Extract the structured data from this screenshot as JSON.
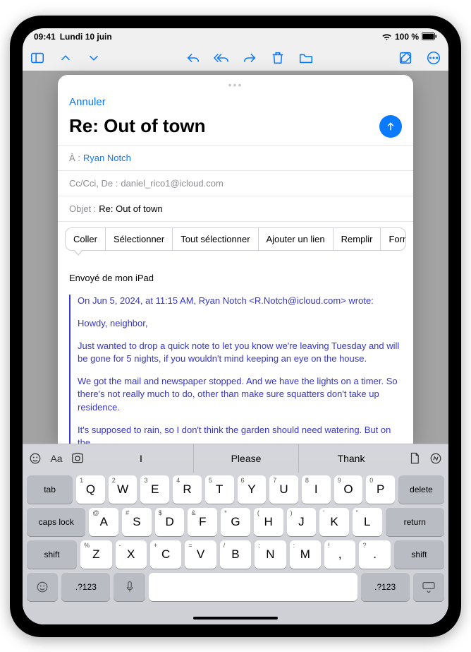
{
  "status": {
    "time": "09:41",
    "date": "Lundi 10 juin",
    "battery": "100 %"
  },
  "sheet": {
    "cancel": "Annuler",
    "title": "Re: Out of town",
    "to_label": "À :",
    "to_value": "Ryan Notch",
    "cc_label": "Cc/Cci, De :",
    "cc_value": "daniel_rico1@icloud.com",
    "subject_label": "Objet :",
    "subject_value": "Re: Out of town"
  },
  "edit_menu": {
    "paste": "Coller",
    "select": "Sélectionner",
    "select_all": "Tout sélectionner",
    "add_link": "Ajouter un lien",
    "fill": "Remplir",
    "format": "Format"
  },
  "body": {
    "signature": "Envoyé de mon iPad",
    "quote_header": "On Jun 5, 2024, at 11:15 AM, Ryan Notch <R.Notch@icloud.com> wrote:",
    "p1": "Howdy, neighbor,",
    "p2": "Just wanted to drop a quick note to let you know we're leaving Tuesday and will be gone for 5 nights, if you wouldn't mind keeping an eye on the house.",
    "p3": "We got the mail and newspaper stopped. And we have the lights on a timer. So there's not really much to do, other than make sure squatters don't take up residence.",
    "p4": "It's supposed to rain, so I don't think the garden should need watering. But on the"
  },
  "keyboard": {
    "sugg": [
      "I",
      "Please",
      "Thank"
    ],
    "row1": [
      {
        "m": "Q",
        "a": "1"
      },
      {
        "m": "W",
        "a": "2"
      },
      {
        "m": "E",
        "a": "3"
      },
      {
        "m": "R",
        "a": "4"
      },
      {
        "m": "T",
        "a": "5"
      },
      {
        "m": "Y",
        "a": "6"
      },
      {
        "m": "U",
        "a": "7"
      },
      {
        "m": "I",
        "a": "8"
      },
      {
        "m": "O",
        "a": "9"
      },
      {
        "m": "P",
        "a": "0"
      }
    ],
    "row2": [
      {
        "m": "A",
        "a": "@"
      },
      {
        "m": "S",
        "a": "#"
      },
      {
        "m": "D",
        "a": "$"
      },
      {
        "m": "F",
        "a": "&"
      },
      {
        "m": "G",
        "a": "*"
      },
      {
        "m": "H",
        "a": "("
      },
      {
        "m": "J",
        "a": ")"
      },
      {
        "m": "K",
        "a": "'"
      },
      {
        "m": "L",
        "a": "\""
      }
    ],
    "row3": [
      {
        "m": "Z",
        "a": "%"
      },
      {
        "m": "X",
        "a": "-"
      },
      {
        "m": "C",
        "a": "+"
      },
      {
        "m": "V",
        "a": "="
      },
      {
        "m": "B",
        "a": "/"
      },
      {
        "m": "N",
        "a": ";"
      },
      {
        "m": "M",
        "a": ":"
      },
      {
        "m": ",",
        "a": "!"
      },
      {
        "m": ".",
        "a": "?"
      }
    ],
    "tab": "tab",
    "delete": "delete",
    "caps": "caps lock",
    "ret": "return",
    "shift": "shift",
    "num": ".?123",
    "font": "Aa"
  }
}
